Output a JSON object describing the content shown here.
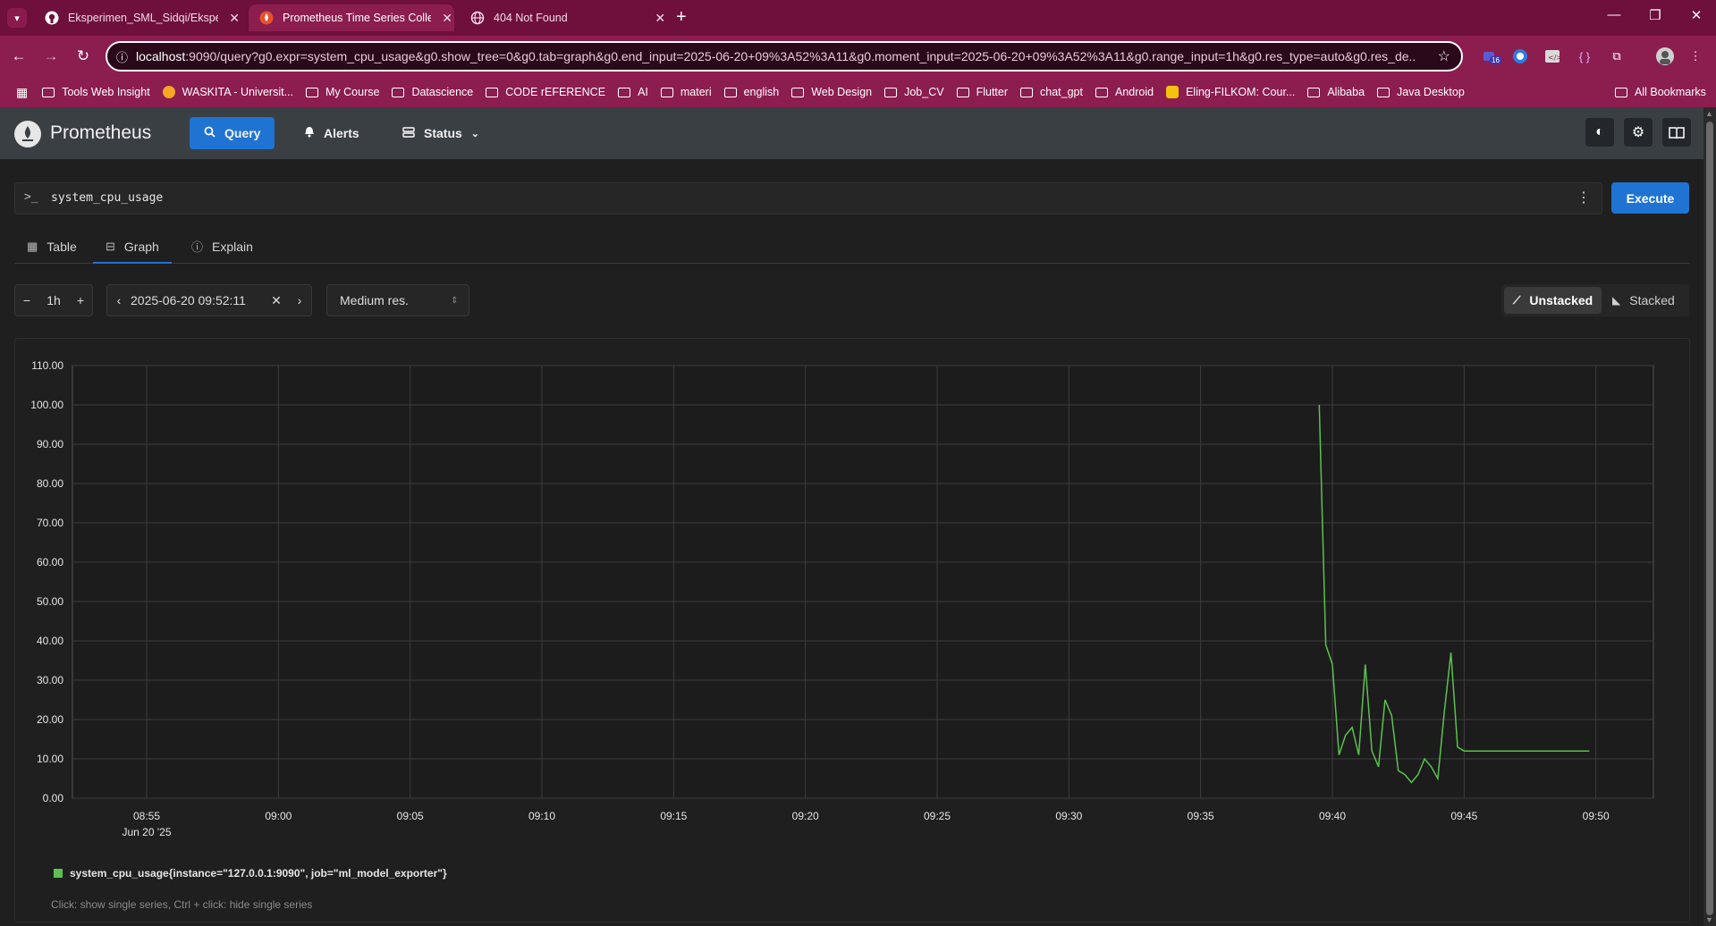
{
  "browser": {
    "tabs": [
      {
        "title": "Eksperimen_SML_Sidqi/Eksperim",
        "icon": "github-icon"
      },
      {
        "title": "Prometheus Time Series Collect",
        "icon": "prometheus-icon",
        "active": true
      },
      {
        "title": "404 Not Found",
        "icon": "globe-icon"
      }
    ],
    "url_host": "localhost",
    "url_rest": ":9090/query?g0.expr=system_cpu_usage&g0.show_tree=0&g0.tab=graph&g0.end_input=2025-06-20+09%3A52%3A11&g0.moment_input=2025-06-20+09%3A52%3A11&g0.range_input=1h&g0.res_type=auto&g0.res_de...",
    "extension_badge": "16",
    "bookmarks": [
      "Tools Web Insight",
      "WASKITA - Universit...",
      "My Course",
      "Datascience",
      "CODE rEFERENCE",
      "AI",
      "materi",
      "english",
      "Web Design",
      "Job_CV",
      "Flutter",
      "chat_gpt",
      "Android",
      "Eling-FILKOM: Cour...",
      "Alibaba",
      "Java Desktop"
    ],
    "all_bookmarks": "All Bookmarks"
  },
  "nav": {
    "brand": "Prometheus",
    "query": "Query",
    "alerts": "Alerts",
    "status": "Status"
  },
  "query": {
    "prompt": ">_",
    "expression": "system_cpu_usage",
    "execute": "Execute"
  },
  "tabs": {
    "table": "Table",
    "graph": "Graph",
    "explain": "Explain"
  },
  "controls": {
    "range": "1h",
    "end_time": "2025-06-20 09:52:11",
    "resolution": "Medium res.",
    "unstacked": "Unstacked",
    "stacked": "Stacked"
  },
  "legend": {
    "series": "system_cpu_usage{instance=\"127.0.0.1:9090\", job=\"ml_model_exporter\"}",
    "hint": "Click: show single series, Ctrl + click: hide single series"
  },
  "colors": {
    "accent": "#1f73d2",
    "series": "#5cc14f",
    "browser": "#8c1d4f"
  },
  "chart_data": {
    "type": "line",
    "ylim": [
      0,
      110
    ],
    "xlim": [
      "08:52:11",
      "09:52:11"
    ],
    "yticks": [
      "0.00",
      "10.00",
      "20.00",
      "30.00",
      "40.00",
      "50.00",
      "60.00",
      "70.00",
      "80.00",
      "90.00",
      "100.00",
      "110.00"
    ],
    "xticks": [
      "08:55",
      "09:00",
      "09:05",
      "09:10",
      "09:15",
      "09:20",
      "09:25",
      "09:30",
      "09:35",
      "09:40",
      "09:45",
      "09:50"
    ],
    "xtick_sub": {
      "08:55": "Jun 20 '25"
    },
    "grid": true,
    "series": [
      {
        "name": "system_cpu_usage{instance=\"127.0.0.1:9090\", job=\"ml_model_exporter\"}",
        "x": [
          "09:39:30",
          "09:39:45",
          "09:40:00",
          "09:40:15",
          "09:40:30",
          "09:40:45",
          "09:41:00",
          "09:41:15",
          "09:41:30",
          "09:41:45",
          "09:42:00",
          "09:42:15",
          "09:42:30",
          "09:42:45",
          "09:43:00",
          "09:43:15",
          "09:43:30",
          "09:43:45",
          "09:44:00",
          "09:44:15",
          "09:44:30",
          "09:44:45",
          "09:45:00",
          "09:45:15",
          "09:46:00",
          "09:47:00",
          "09:48:00",
          "09:49:00",
          "09:49:45"
        ],
        "y": [
          100,
          39,
          34,
          11,
          16,
          18,
          11,
          34,
          12,
          8,
          25,
          21,
          7,
          6,
          4,
          6,
          10,
          8,
          5,
          22,
          37,
          13,
          12,
          12,
          12,
          12,
          12,
          12,
          12
        ]
      }
    ]
  }
}
